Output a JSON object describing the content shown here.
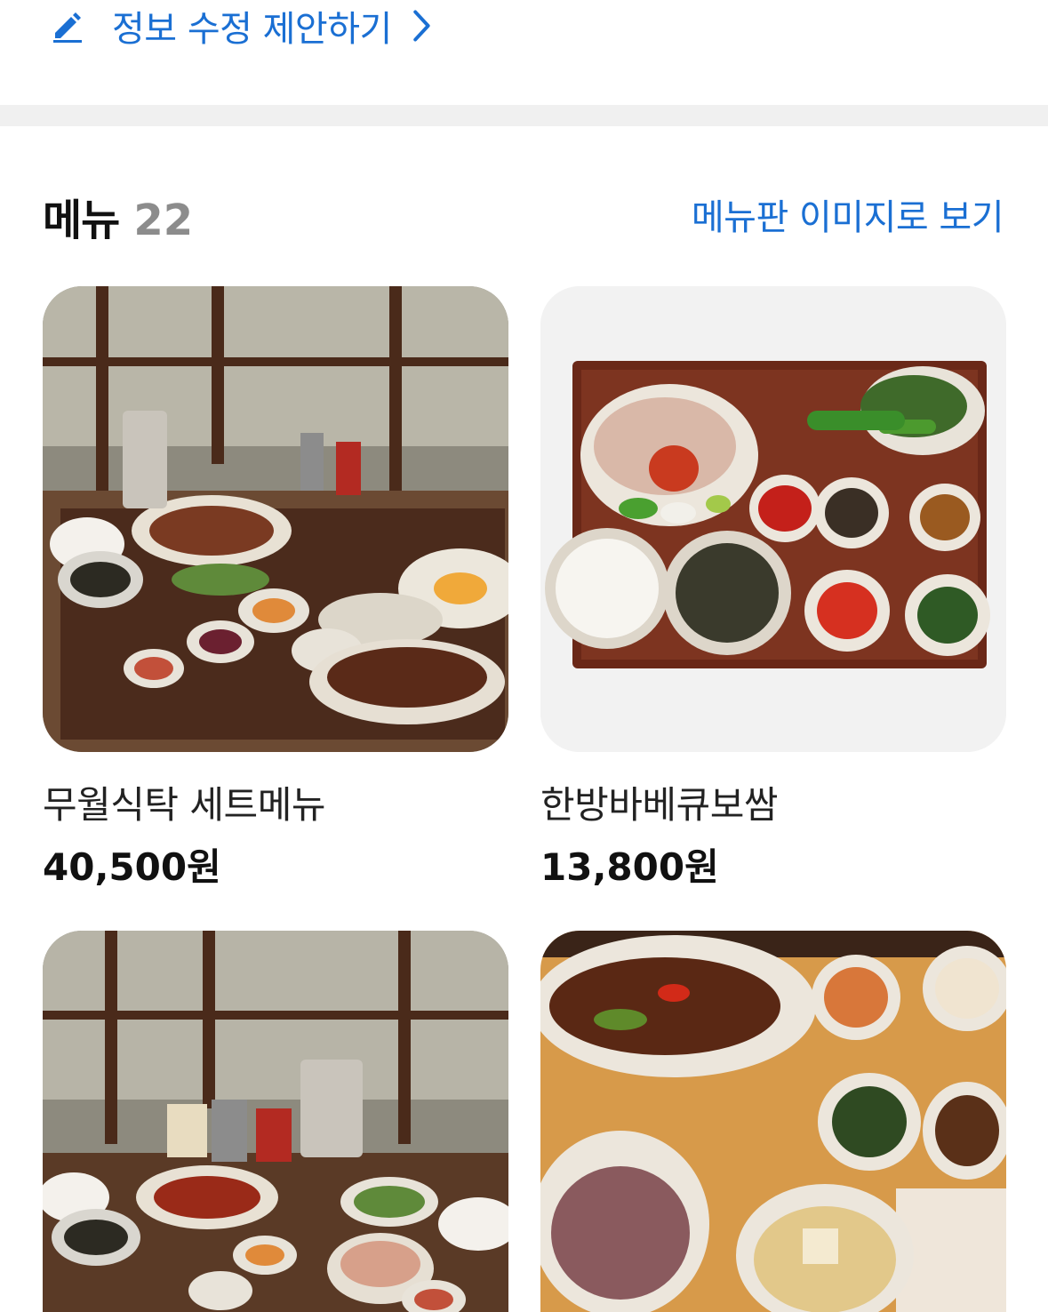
{
  "suggest_edit": {
    "label": "정보 수정 제안하기",
    "icon": "pencil-icon"
  },
  "menu": {
    "title": "메뉴",
    "count": "22",
    "view_board_label": "메뉴판 이미지로 보기",
    "items": [
      {
        "name": "무월식탁 세트메뉴",
        "price": "40,500원",
        "image": "window-table-set-photo"
      },
      {
        "name": "한방바베큐보쌈",
        "price": "13,800원",
        "image": "bossam-tray-photo"
      },
      {
        "name": "",
        "price": "",
        "image": "window-table-set-photo-2"
      },
      {
        "name": "",
        "price": "",
        "image": "stirfry-rice-set-photo"
      }
    ]
  },
  "colors": {
    "link": "#1a6fd3",
    "divider": "#f0f0f0",
    "count": "#8c8c8c"
  }
}
